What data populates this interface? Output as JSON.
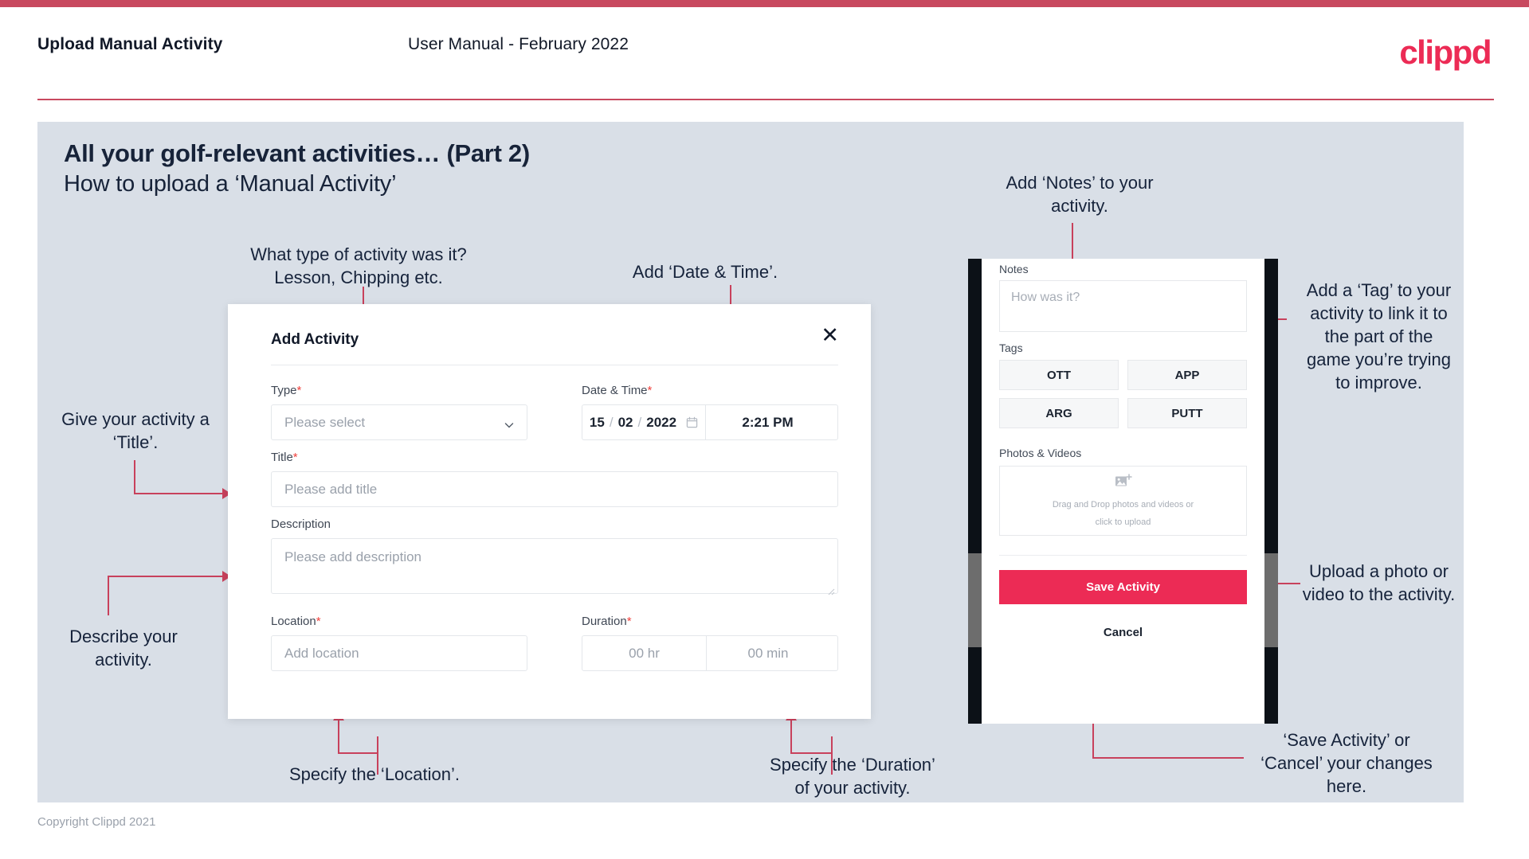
{
  "header": {
    "title": "Upload Manual Activity",
    "subtitle": "User Manual - February 2022",
    "logo": "clippd"
  },
  "slide": {
    "heading": "All your golf-relevant activities… (Part 2)",
    "subheading": "How to upload a ‘Manual Activity’"
  },
  "annotations": {
    "type": "What type of activity was it?\nLesson, Chipping etc.",
    "datetime": "Add ‘Date & Time’.",
    "notes": "Add ‘Notes’ to your\nactivity.",
    "tag": "Add a ‘Tag’ to your\nactivity to link it to\nthe part of the\ngame you’re trying\nto improve.",
    "title": "Give your activity a\n‘Title’.",
    "description": "Describe your\nactivity.",
    "location": "Specify the ‘Location’.",
    "duration": "Specify the ‘Duration’\nof your activity.",
    "upload": "Upload a photo or\nvideo to the activity.",
    "save_cancel": "‘Save Activity’ or\n‘Cancel’ your changes\nhere."
  },
  "dialog": {
    "title": "Add Activity",
    "close_label": "✕",
    "type": {
      "label": "Type",
      "required": "*",
      "placeholder": "Please select"
    },
    "datetime": {
      "label": "Date & Time",
      "required": "*",
      "day": "15",
      "month": "02",
      "year": "2022",
      "sep1": "/",
      "sep2": "/",
      "time": "2:21 PM"
    },
    "title_field": {
      "label": "Title",
      "required": "*",
      "placeholder": "Please add title"
    },
    "description": {
      "label": "Description",
      "placeholder": "Please add description"
    },
    "location": {
      "label": "Location",
      "required": "*",
      "placeholder": "Add location"
    },
    "duration": {
      "label": "Duration",
      "required": "*",
      "hours": "00 hr",
      "minutes": "00 min"
    }
  },
  "phone": {
    "notes": {
      "label": "Notes",
      "placeholder": "How was it?"
    },
    "tags": {
      "label": "Tags",
      "items": [
        "OTT",
        "APP",
        "ARG",
        "PUTT"
      ]
    },
    "photos": {
      "label": "Photos & Videos",
      "drop_line1": "Drag and Drop photos and videos or",
      "drop_line2": "click to upload"
    },
    "save_label": "Save Activity",
    "cancel_label": "Cancel"
  },
  "footer": {
    "copyright": "Copyright Clippd 2021"
  },
  "colors": {
    "accent": "#ec2b55",
    "bar": "#c8495f",
    "connector": "#c8415c",
    "slide_bg": "#d9dfe7",
    "text_dark": "#16233b"
  }
}
